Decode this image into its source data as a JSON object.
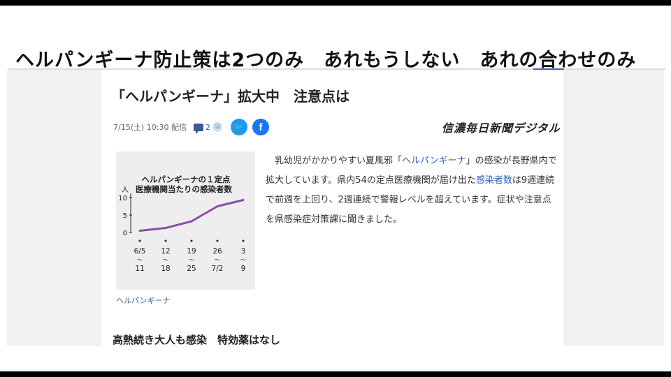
{
  "overlay": {
    "caption": "ヘルパンギーナ防止策は2つのみ　あれもうしない　あれの合わせのみ"
  },
  "article": {
    "headline": "「ヘルパンギーナ」拡大中　注意点は",
    "date": "7/15(土) 10:30 配信",
    "comment_count": "2",
    "brand": "信濃毎日新聞デジタル",
    "body": {
      "p1_a": "乳幼児がかかりやすい夏風邪「",
      "p1_link1": "ヘルパンギーナ",
      "p1_b": "」の感染が長野県内で拡大しています。県内54の定点医療機関が届け出た",
      "p1_link2": "感染者数",
      "p1_c": "は9週連続で前週を上回り、2週連続で警報レベルを超えています。症状や注意点を県感染症対策課に聞きました。"
    },
    "figure_caption": "ヘルパンギーナ",
    "subheading": "高熱続き大人も感染　特効薬はなし"
  },
  "icons": {
    "comment": "comment-icon",
    "reaction": "smile-icon",
    "twitter": "twitter-icon",
    "facebook": "facebook-icon"
  },
  "colors": {
    "link": "#2f5fb5",
    "twitter": "#1d9bf0",
    "facebook": "#1877f2",
    "chart_line": "#8a4fa0"
  },
  "chart_data": {
    "type": "line",
    "title_line1": "ヘルパンギーナの１定点",
    "title_line2": "医療機関当たりの感染者数",
    "ylabel": "人",
    "yticks": [
      "10",
      "5",
      "0"
    ],
    "ylim": [
      0,
      10
    ],
    "categories": [
      {
        "top": "6/5",
        "bottom": "11"
      },
      {
        "top": "12",
        "bottom": "18"
      },
      {
        "top": "19",
        "bottom": "25"
      },
      {
        "top": "26",
        "bottom": "7/2"
      },
      {
        "top": "3",
        "bottom": "9"
      }
    ],
    "range_mark": "〜",
    "values": [
      0.5,
      1.3,
      3.2,
      7.5,
      9.3
    ]
  }
}
